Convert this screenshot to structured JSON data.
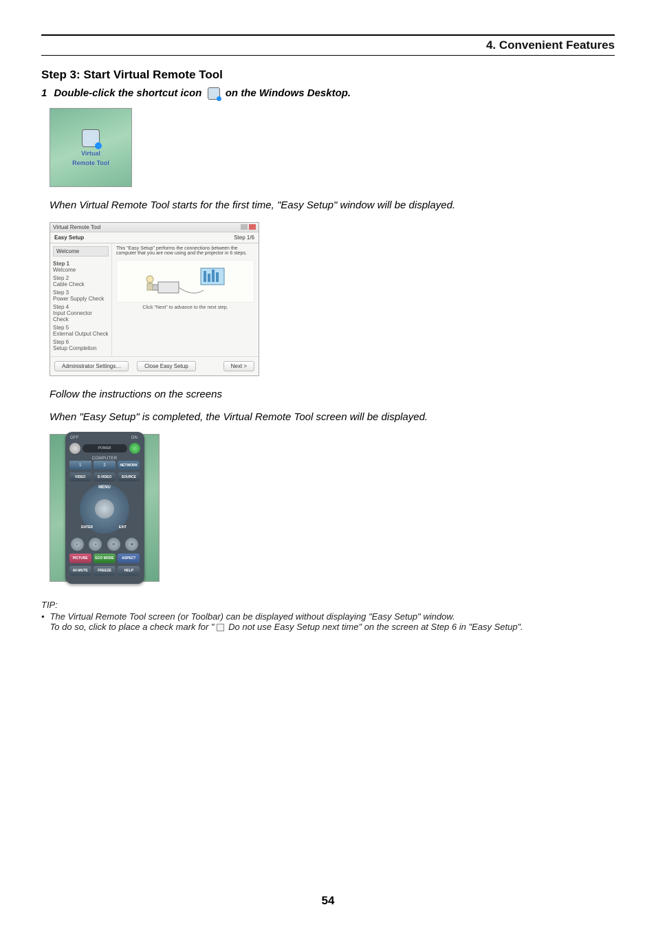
{
  "header": {
    "chapter": "4. Convenient Features"
  },
  "stepTitle": "Step 3: Start Virtual Remote Tool",
  "instruction": {
    "num": "1",
    "part1": "Double-click the shortcut icon ",
    "part2": " on the Windows Desktop."
  },
  "desktopIcon": {
    "label1": "Virtual",
    "label2": "Remote Tool"
  },
  "caption1": "When Virtual Remote Tool starts for the first time, \"Easy Setup\" window will be displayed.",
  "easySetup": {
    "windowTitle": "Virtual Remote Tool",
    "title": "Easy Setup",
    "stepIndicator": "Step 1/6",
    "welcome": "Welcome",
    "steps": [
      {
        "num": "Step 1",
        "label": "Welcome"
      },
      {
        "num": "Step 2",
        "label": "Cable Check"
      },
      {
        "num": "Step 3",
        "label": "Power Supply Check"
      },
      {
        "num": "Step 4",
        "label": "Input Connector Check"
      },
      {
        "num": "Step 5",
        "label": "External Output Check"
      },
      {
        "num": "Step 6",
        "label": "Setup Completion"
      }
    ],
    "desc": "This \"Easy Setup\" performs the connections between the computer that you are now using and the projector in 6 steps.",
    "hint": "Click \"Next\" to advance to the next step.",
    "btnAdmin": "Administrator Settings…",
    "btnClose": "Close Easy Setup",
    "btnNext": "Next >"
  },
  "caption2": "Follow the instructions on the screens",
  "caption3": "When \"Easy Setup\" is completed, the Virtual Remote Tool screen will be displayed.",
  "remote": {
    "off": "OFF",
    "on": "ON",
    "power": "POWER",
    "computer": "COMPUTER",
    "n1": "1",
    "n2": "2",
    "n3": "NETWORK",
    "video": "VIDEO",
    "svideo": "S-VIDEO",
    "source": "SOURCE",
    "menu": "MENU",
    "enter": "ENTER",
    "exit": "EXIT",
    "picture": "PICTURE",
    "eco": "ECO MODE",
    "aspect": "ASPECT",
    "avmute": "AV-MUTE",
    "freeze": "FREEZE",
    "help": "HELP"
  },
  "tip": {
    "label": "TIP:",
    "bullet1": "The Virtual Remote Tool screen (or Toolbar) can be displayed without displaying \"Easy Setup\" window.",
    "bullet2a": "To do so, click to place a check mark for \"",
    "bullet2b": " Do not use Easy Setup next time\" on the screen at Step 6 in \"Easy Setup\"."
  },
  "pageNumber": "54"
}
